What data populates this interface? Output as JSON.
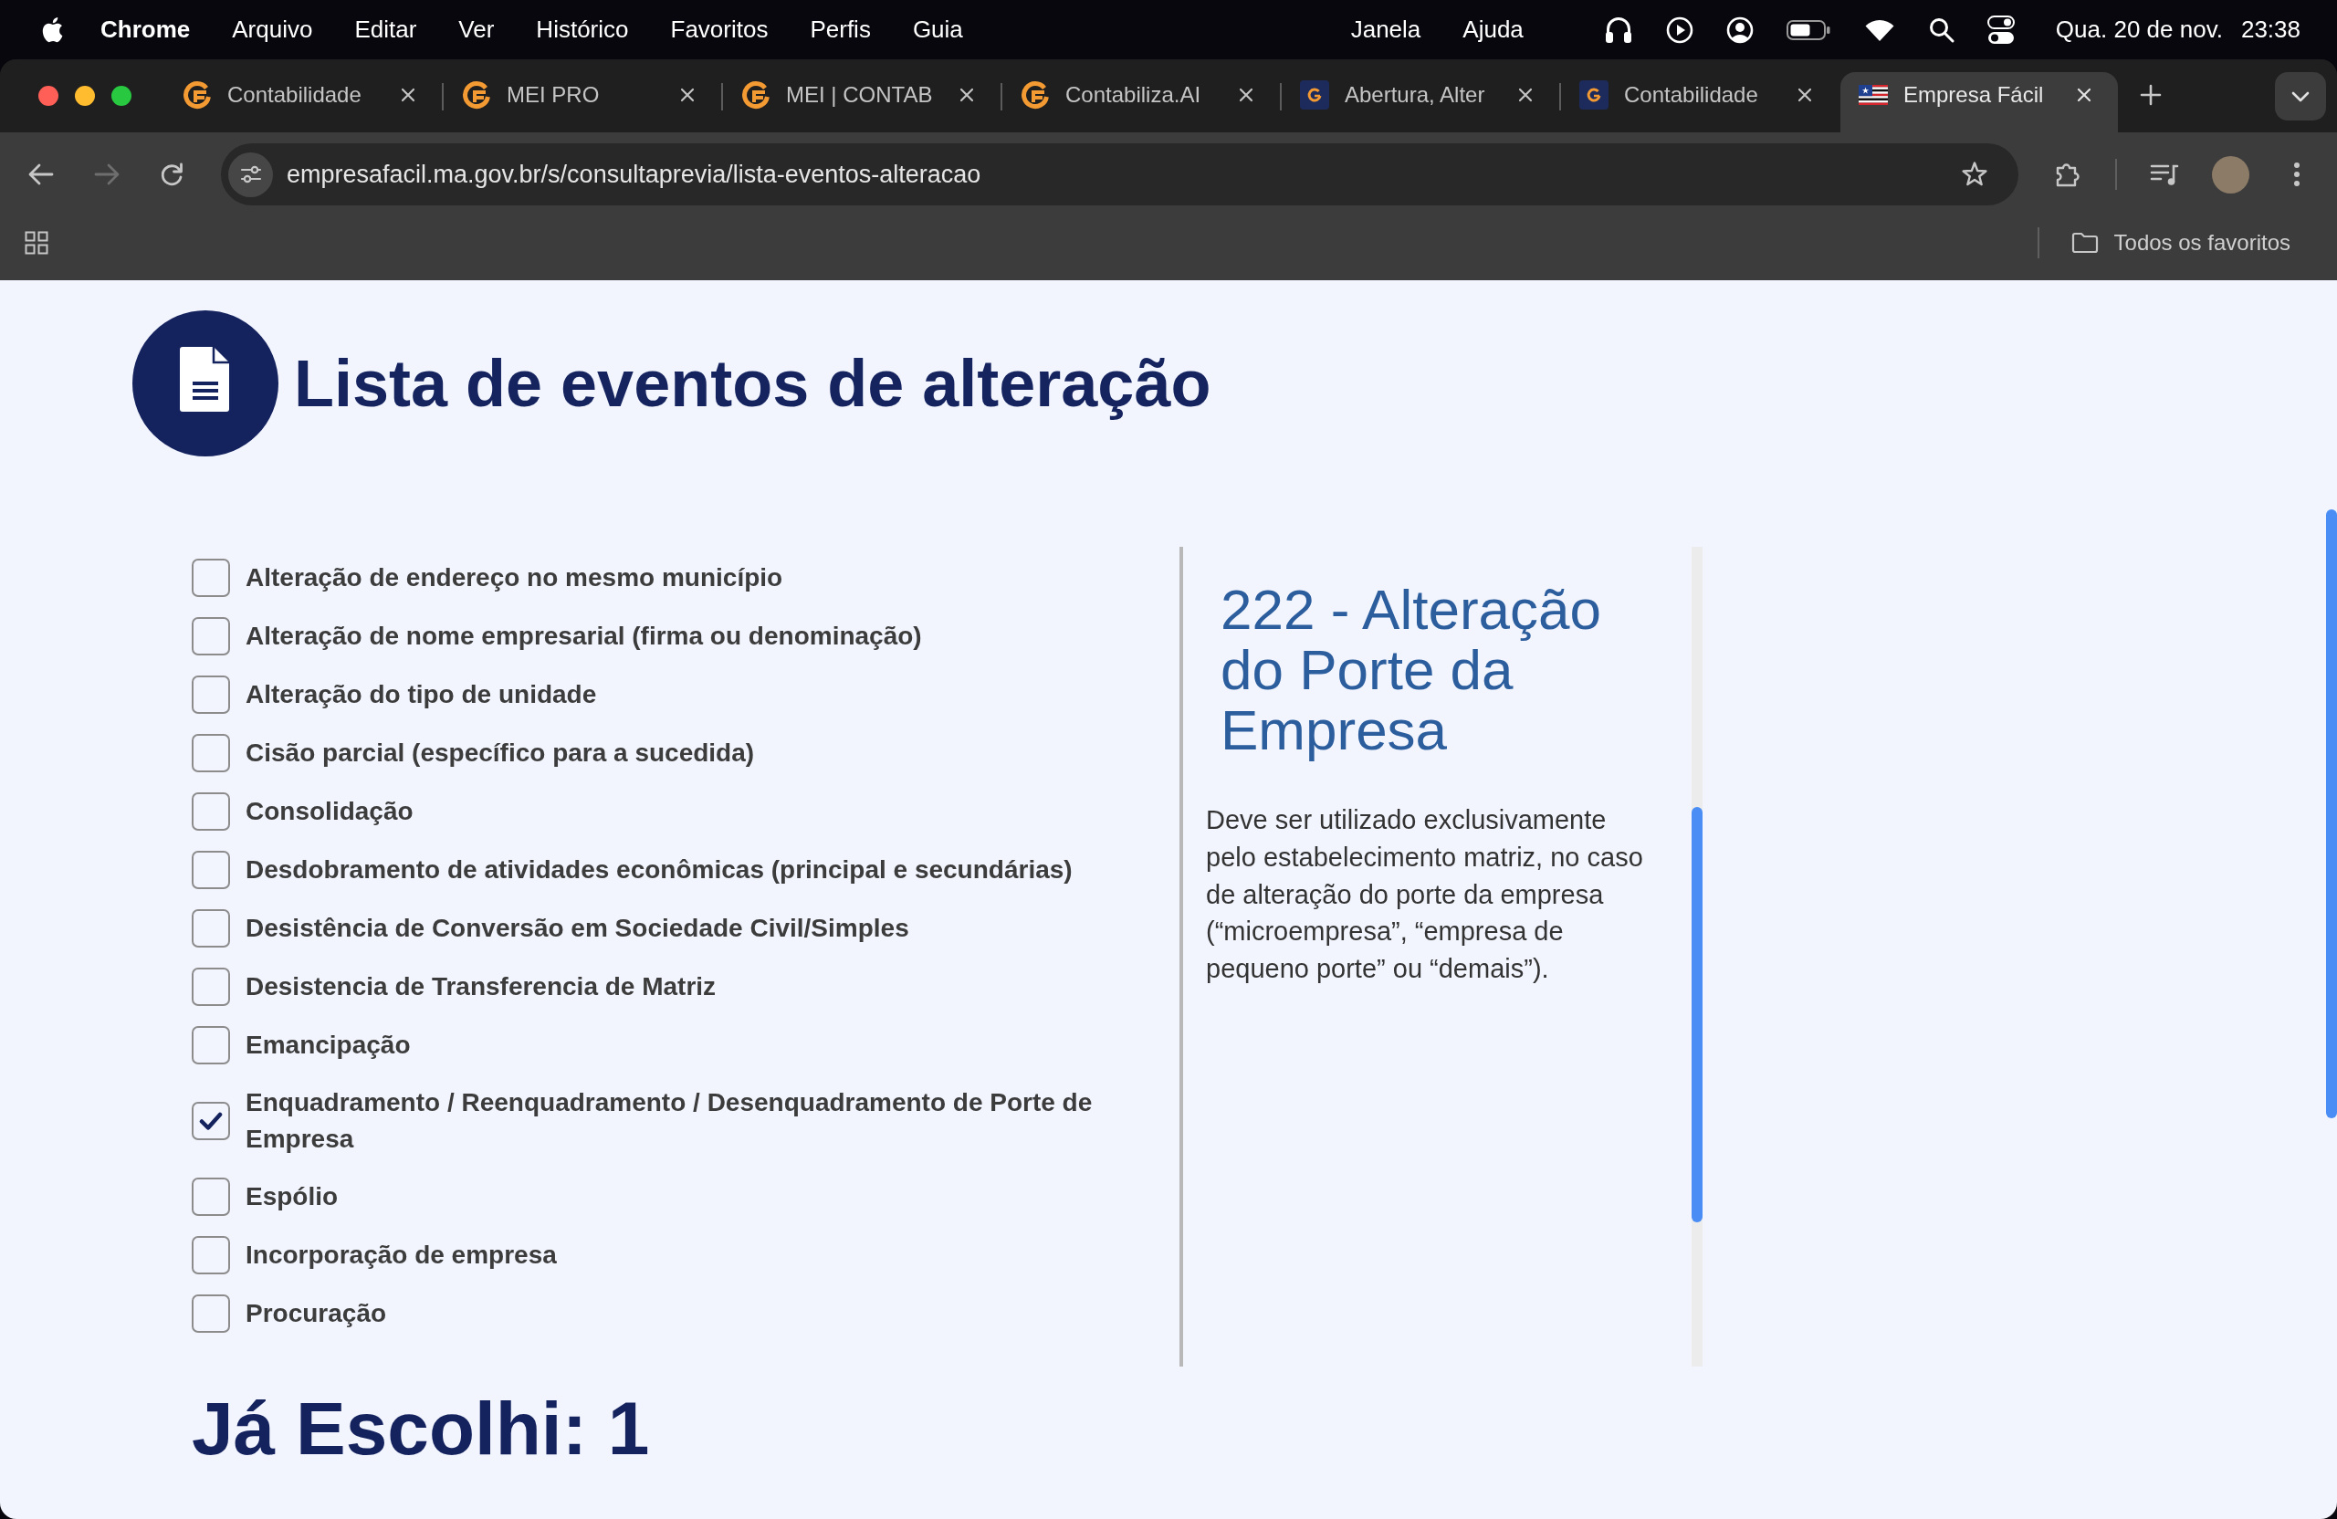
{
  "menu_bar": {
    "app_name": "Chrome",
    "menus": [
      "Arquivo",
      "Editar",
      "Ver",
      "Histórico",
      "Favoritos",
      "Perfis",
      "Guia"
    ],
    "menus_right": [
      "Janela",
      "Ajuda"
    ],
    "date": "Qua. 20 de nov.",
    "time": "23:38"
  },
  "tabs": [
    {
      "title": "Contabilidade",
      "kind": "orange",
      "selected": false
    },
    {
      "title": "MEI PRO",
      "kind": "orange",
      "selected": false
    },
    {
      "title": "MEI | CONTAB",
      "kind": "orange",
      "selected": false
    },
    {
      "title": "Contabiliza.AI",
      "kind": "orange",
      "selected": false
    },
    {
      "title": "Abertura, Alter",
      "kind": "navy",
      "selected": false
    },
    {
      "title": "Contabilidade",
      "kind": "navy",
      "selected": false
    },
    {
      "title": "Empresa Fácil",
      "kind": "flag",
      "selected": true
    }
  ],
  "toolbar": {
    "back_disabled": false,
    "forward_disabled": true,
    "url": "empresafacil.ma.gov.br/s/consultaprevia/lista-eventos-alteracao"
  },
  "bookmarks_bar": {
    "folder": "Todos os favoritos"
  },
  "page": {
    "title": "Lista de eventos de alteração",
    "events": [
      {
        "label": "Alteração de endereço no mesmo município",
        "checked": false
      },
      {
        "label": "Alteração de nome empresarial (firma ou denominação)",
        "checked": false
      },
      {
        "label": "Alteração do tipo de unidade",
        "checked": false
      },
      {
        "label": "Cisão parcial (específico para a sucedida)",
        "checked": false
      },
      {
        "label": "Consolidação",
        "checked": false
      },
      {
        "label": "Desdobramento de atividades econômicas (principal e secundárias)",
        "checked": false
      },
      {
        "label": "Desistência de Conversão em Sociedade Civil/Simples",
        "checked": false
      },
      {
        "label": "Desistencia de Transferencia de Matriz",
        "checked": false
      },
      {
        "label": "Emancipação",
        "checked": false
      },
      {
        "label": "Enquadramento / Reenquadramento / Desenquadramento de Porte de Empresa",
        "checked": true
      },
      {
        "label": "Espólio",
        "checked": false
      },
      {
        "label": "Incorporação de empresa",
        "checked": false
      },
      {
        "label": "Procuração",
        "checked": false
      }
    ],
    "detail": {
      "heading": "222 - Alteração do Porte da Empresa",
      "description": "Deve ser utilizado exclusivamente pelo estabelecimento matriz, no caso de alteração do porte da empresa (“microempresa”, “empresa de pequeno porte” ou “demais”)."
    },
    "chosen": "Já Escolhi: 1"
  }
}
